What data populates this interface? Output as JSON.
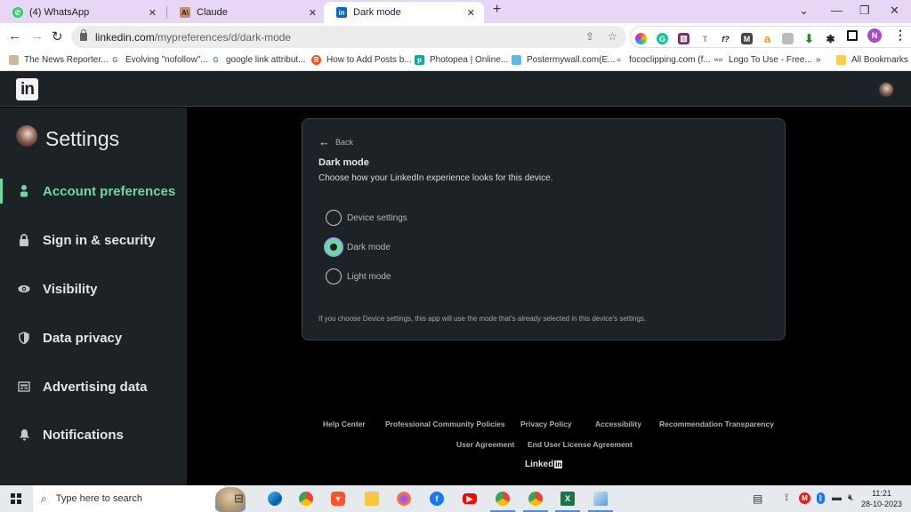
{
  "browser": {
    "tabs": [
      {
        "label": "(4) WhatsApp",
        "icon": "whatsapp-icon",
        "active": false
      },
      {
        "label": "Claude",
        "icon": "claude-icon",
        "active": false
      },
      {
        "label": "Dark mode",
        "icon": "linkedin-icon",
        "active": true
      }
    ],
    "new_tab": "+",
    "window_controls": {
      "tab_search": "⌄",
      "minimize": "—",
      "restore": "❐",
      "close": "✕"
    },
    "url_host": "linkedin.com",
    "url_path": "/mypreferences/d/dark-mode",
    "profile_initial": "N",
    "extensions": [
      "color-picker-icon",
      "grammarly-icon",
      "extension-icon",
      "text-icon",
      "font-icon",
      "m-icon",
      "a-icon",
      "screenshot-icon",
      "download-icon",
      "puzzle-icon"
    ],
    "bookmarks": [
      "The News Reporter...",
      "Evolving \"nofollow\"...",
      "google link attribut...",
      "How to Add Posts b...",
      "Photopea | Online...",
      "Postermywall.com(E...",
      "fococlipping.com (f...",
      "Logo To Use - Free..."
    ],
    "bookmarks_more": "»",
    "all_bookmarks": "All Bookmarks"
  },
  "linkedin": {
    "logo": "in",
    "settings_title": "Settings",
    "sidebar": [
      {
        "label": "Account preferences",
        "icon": "person-icon",
        "active": true
      },
      {
        "label": "Sign in & security",
        "icon": "lock-icon",
        "active": false
      },
      {
        "label": "Visibility",
        "icon": "eye-icon",
        "active": false
      },
      {
        "label": "Data privacy",
        "icon": "shield-icon",
        "active": false
      },
      {
        "label": "Advertising data",
        "icon": "ad-card-icon",
        "active": false
      },
      {
        "label": "Notifications",
        "icon": "bell-icon",
        "active": false
      }
    ],
    "card": {
      "back_label": "Back",
      "title": "Dark mode",
      "description": "Choose how your LinkedIn experience looks for this device.",
      "options": [
        {
          "label": "Device settings",
          "checked": false
        },
        {
          "label": "Dark mode",
          "checked": true
        },
        {
          "label": "Light mode",
          "checked": false
        }
      ],
      "note": "If you choose Device settings, this app will use the mode that's already selected in this device's settings."
    },
    "footer": {
      "links_row1": [
        "Help Center",
        "Professional Community Policies",
        "Privacy Policy",
        "Accessibility",
        "Recommendation Transparency"
      ],
      "links_row2": [
        "User Agreement",
        "End User License Agreement"
      ],
      "brand_text": "Linked",
      "brand_in": "in"
    },
    "accent_color": "#71d6a2"
  },
  "taskbar": {
    "search_placeholder": "Type here to search",
    "time": "11:21",
    "date": "28-10-2023"
  }
}
